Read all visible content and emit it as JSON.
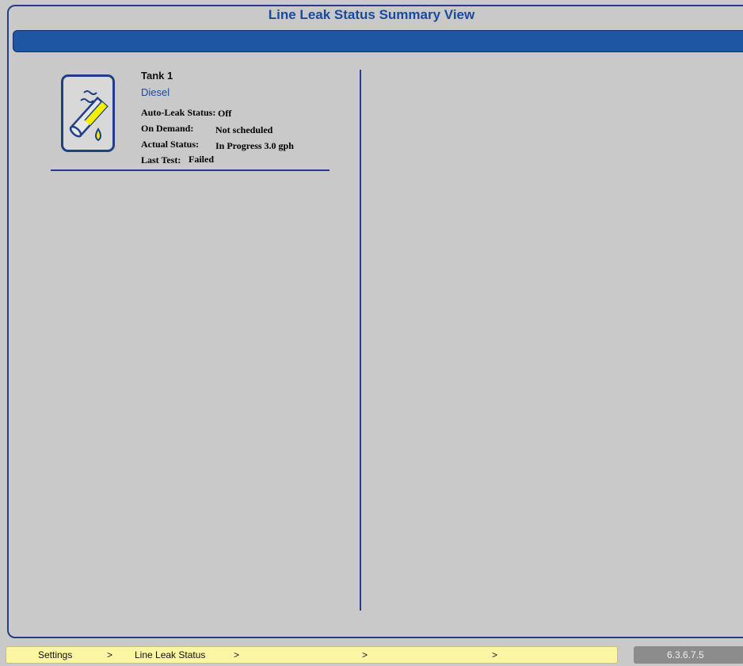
{
  "page": {
    "title": "Line Leak Status Summary View"
  },
  "tank": {
    "name": "Tank 1",
    "product": "Diesel",
    "icon": "line-leak-pipe-icon",
    "auto_leak_label": "Auto-Leak Status:",
    "auto_leak_value": "Off",
    "on_demand_label": "On Demand:",
    "on_demand_value": "Not scheduled",
    "actual_status_label": "Actual Status:",
    "actual_status_value": "In Progress 3.0 gph",
    "last_test_label": "Last Test:",
    "last_test_value": "Failed"
  },
  "breadcrumb": {
    "items": [
      "Settings",
      "Line Leak Status",
      "",
      ""
    ],
    "separator": ">"
  },
  "version": "6.3.6.7.5",
  "colors": {
    "accent": "#1f56a3",
    "border": "#1f3f86",
    "background": "#c9c9c9",
    "breadcrumb_bg": "#fbf6a3",
    "icon_fluid": "#f5f000"
  }
}
